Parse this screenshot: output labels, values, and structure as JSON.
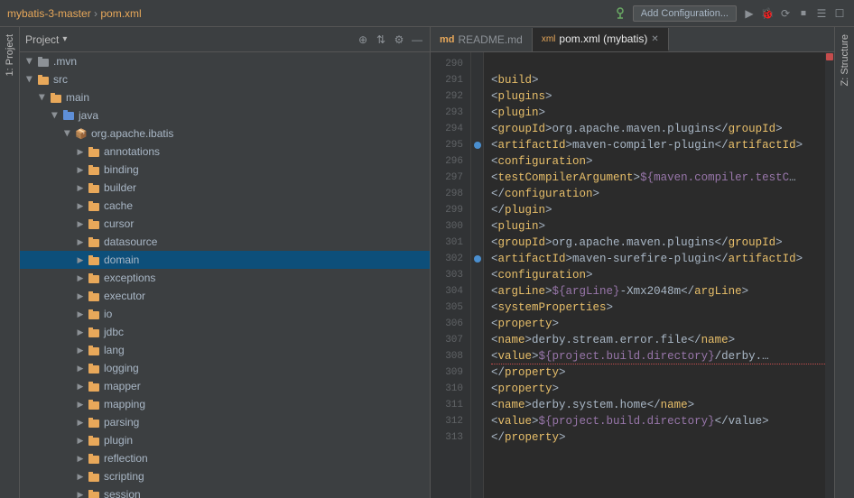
{
  "titleBar": {
    "projectName": "mybatis-3-master",
    "separator": " › ",
    "fileName": "pom.xml",
    "addConfigLabel": "Add Configuration...",
    "icons": [
      "▶",
      "⏸",
      "⟳",
      "⏹",
      "☰",
      "☐"
    ]
  },
  "projectPanel": {
    "title": "Project",
    "dropdownArrow": "▾",
    "headerIcons": [
      "⊕",
      "⇅",
      "⚙",
      "—"
    ]
  },
  "tabs": [
    {
      "id": "readme",
      "label": "README.md",
      "iconType": "md",
      "active": false
    },
    {
      "id": "pomxml",
      "label": "pom.xml (mybatis)",
      "iconType": "xml",
      "active": true
    }
  ],
  "fileTree": [
    {
      "indent": 0,
      "type": "folder",
      "open": true,
      "label": ".mvn",
      "color": "gray"
    },
    {
      "indent": 0,
      "type": "folder",
      "open": true,
      "label": "src",
      "color": "orange"
    },
    {
      "indent": 1,
      "type": "folder",
      "open": true,
      "label": "main",
      "color": "orange"
    },
    {
      "indent": 2,
      "type": "folder",
      "open": true,
      "label": "java",
      "color": "blue"
    },
    {
      "indent": 3,
      "type": "package",
      "open": true,
      "label": "org.apache.ibatis",
      "color": "package"
    },
    {
      "indent": 4,
      "type": "folder",
      "open": false,
      "label": "annotations",
      "color": "orange"
    },
    {
      "indent": 4,
      "type": "folder",
      "open": false,
      "label": "binding",
      "color": "orange"
    },
    {
      "indent": 4,
      "type": "folder",
      "open": false,
      "label": "builder",
      "color": "orange"
    },
    {
      "indent": 4,
      "type": "folder",
      "open": false,
      "label": "cache",
      "color": "orange"
    },
    {
      "indent": 4,
      "type": "folder",
      "open": false,
      "label": "cursor",
      "color": "orange"
    },
    {
      "indent": 4,
      "type": "folder",
      "open": false,
      "label": "datasource",
      "color": "orange"
    },
    {
      "indent": 4,
      "type": "folder",
      "open": false,
      "label": "domain",
      "color": "orange",
      "selected": true
    },
    {
      "indent": 4,
      "type": "folder",
      "open": false,
      "label": "exceptions",
      "color": "orange"
    },
    {
      "indent": 4,
      "type": "folder",
      "open": false,
      "label": "executor",
      "color": "orange"
    },
    {
      "indent": 4,
      "type": "folder",
      "open": false,
      "label": "io",
      "color": "orange"
    },
    {
      "indent": 4,
      "type": "folder",
      "open": false,
      "label": "jdbc",
      "color": "orange"
    },
    {
      "indent": 4,
      "type": "folder",
      "open": false,
      "label": "lang",
      "color": "orange"
    },
    {
      "indent": 4,
      "type": "folder",
      "open": false,
      "label": "logging",
      "color": "orange"
    },
    {
      "indent": 4,
      "type": "folder",
      "open": false,
      "label": "mapper",
      "color": "orange"
    },
    {
      "indent": 4,
      "type": "folder",
      "open": false,
      "label": "mapping",
      "color": "orange"
    },
    {
      "indent": 4,
      "type": "folder",
      "open": false,
      "label": "parsing",
      "color": "orange"
    },
    {
      "indent": 4,
      "type": "folder",
      "open": false,
      "label": "plugin",
      "color": "orange"
    },
    {
      "indent": 4,
      "type": "folder",
      "open": false,
      "label": "reflection",
      "color": "orange"
    },
    {
      "indent": 4,
      "type": "folder",
      "open": false,
      "label": "scripting",
      "color": "orange"
    },
    {
      "indent": 4,
      "type": "folder",
      "open": false,
      "label": "session",
      "color": "orange"
    }
  ],
  "codeLines": [
    {
      "num": 290,
      "hasGutter": false,
      "hasDot": false,
      "error": false,
      "tokens": [
        {
          "type": "plain",
          "text": "  "
        }
      ]
    },
    {
      "num": 291,
      "hasGutter": false,
      "hasDot": false,
      "error": false,
      "tokens": [
        {
          "type": "plain",
          "text": "    "
        },
        {
          "type": "bracket",
          "text": "<"
        },
        {
          "type": "tag",
          "text": "build"
        },
        {
          "type": "bracket",
          "text": ">"
        }
      ]
    },
    {
      "num": 292,
      "hasGutter": false,
      "hasDot": false,
      "error": false,
      "tokens": [
        {
          "type": "plain",
          "text": "        "
        },
        {
          "type": "bracket",
          "text": "<"
        },
        {
          "type": "tag",
          "text": "plugins"
        },
        {
          "type": "bracket",
          "text": ">"
        }
      ]
    },
    {
      "num": 293,
      "hasGutter": false,
      "hasDot": false,
      "error": false,
      "tokens": [
        {
          "type": "plain",
          "text": "            "
        },
        {
          "type": "bracket",
          "text": "<"
        },
        {
          "type": "tag",
          "text": "plugin"
        },
        {
          "type": "bracket",
          "text": ">"
        }
      ]
    },
    {
      "num": 294,
      "hasGutter": false,
      "hasDot": false,
      "error": false,
      "tokens": [
        {
          "type": "plain",
          "text": "                "
        },
        {
          "type": "bracket",
          "text": "<"
        },
        {
          "type": "tag",
          "text": "groupId"
        },
        {
          "type": "bracket",
          "text": ">"
        },
        {
          "type": "plain",
          "text": "org.apache.maven.plugins"
        },
        {
          "type": "bracket",
          "text": "</"
        },
        {
          "type": "tag",
          "text": "groupId"
        },
        {
          "type": "bracket",
          "text": ">"
        }
      ]
    },
    {
      "num": 295,
      "hasGutter": true,
      "hasDot": true,
      "error": false,
      "tokens": [
        {
          "type": "plain",
          "text": "                "
        },
        {
          "type": "bracket",
          "text": "<"
        },
        {
          "type": "tag",
          "text": "artifactId"
        },
        {
          "type": "bracket",
          "text": ">"
        },
        {
          "type": "plain",
          "text": "maven-compiler-plugin"
        },
        {
          "type": "bracket",
          "text": "</"
        },
        {
          "type": "tag",
          "text": "artifactId"
        },
        {
          "type": "bracket",
          "text": ">"
        }
      ]
    },
    {
      "num": 296,
      "hasGutter": false,
      "hasDot": false,
      "error": false,
      "tokens": [
        {
          "type": "plain",
          "text": "                "
        },
        {
          "type": "bracket",
          "text": "<"
        },
        {
          "type": "tag",
          "text": "configuration"
        },
        {
          "type": "bracket",
          "text": ">"
        }
      ]
    },
    {
      "num": 297,
      "hasGutter": false,
      "hasDot": false,
      "error": false,
      "tokens": [
        {
          "type": "plain",
          "text": "                    "
        },
        {
          "type": "bracket",
          "text": "<"
        },
        {
          "type": "tag",
          "text": "testCompilerArgument"
        },
        {
          "type": "bracket",
          "text": ">"
        },
        {
          "type": "var",
          "text": "${maven.compiler.testC"
        },
        {
          "type": "plain",
          "text": "…"
        }
      ]
    },
    {
      "num": 298,
      "hasGutter": false,
      "hasDot": false,
      "error": false,
      "tokens": [
        {
          "type": "plain",
          "text": "                "
        },
        {
          "type": "bracket",
          "text": "</"
        },
        {
          "type": "tag",
          "text": "configuration"
        },
        {
          "type": "bracket",
          "text": ">"
        }
      ]
    },
    {
      "num": 299,
      "hasGutter": false,
      "hasDot": false,
      "error": false,
      "tokens": [
        {
          "type": "plain",
          "text": "            "
        },
        {
          "type": "bracket",
          "text": "</"
        },
        {
          "type": "tag",
          "text": "plugin"
        },
        {
          "type": "bracket",
          "text": ">"
        }
      ]
    },
    {
      "num": 300,
      "hasGutter": false,
      "hasDot": false,
      "error": false,
      "tokens": [
        {
          "type": "plain",
          "text": "            "
        },
        {
          "type": "bracket",
          "text": "<"
        },
        {
          "type": "tag",
          "text": "plugin"
        },
        {
          "type": "bracket",
          "text": ">"
        }
      ]
    },
    {
      "num": 301,
      "hasGutter": false,
      "hasDot": false,
      "error": false,
      "tokens": [
        {
          "type": "plain",
          "text": "                "
        },
        {
          "type": "bracket",
          "text": "<"
        },
        {
          "type": "tag",
          "text": "groupId"
        },
        {
          "type": "bracket",
          "text": ">"
        },
        {
          "type": "plain",
          "text": "org.apache.maven.plugins"
        },
        {
          "type": "bracket",
          "text": "</"
        },
        {
          "type": "tag",
          "text": "groupId"
        },
        {
          "type": "bracket",
          "text": ">"
        }
      ]
    },
    {
      "num": 302,
      "hasGutter": true,
      "hasDot": true,
      "error": false,
      "tokens": [
        {
          "type": "plain",
          "text": "                "
        },
        {
          "type": "bracket",
          "text": "<"
        },
        {
          "type": "tag",
          "text": "artifactId"
        },
        {
          "type": "bracket",
          "text": ">"
        },
        {
          "type": "plain",
          "text": "maven-surefire-plugin"
        },
        {
          "type": "bracket",
          "text": "</"
        },
        {
          "type": "tag",
          "text": "artifactId"
        },
        {
          "type": "bracket",
          "text": ">"
        }
      ]
    },
    {
      "num": 303,
      "hasGutter": false,
      "hasDot": false,
      "error": false,
      "tokens": [
        {
          "type": "plain",
          "text": "                "
        },
        {
          "type": "bracket",
          "text": "<"
        },
        {
          "type": "tag",
          "text": "configuration"
        },
        {
          "type": "bracket",
          "text": ">"
        }
      ]
    },
    {
      "num": 304,
      "hasGutter": false,
      "hasDot": false,
      "error": false,
      "tokens": [
        {
          "type": "plain",
          "text": "                    "
        },
        {
          "type": "bracket",
          "text": "<"
        },
        {
          "type": "tag",
          "text": "argLine"
        },
        {
          "type": "bracket",
          "text": ">"
        },
        {
          "type": "var",
          "text": "${argLine}"
        },
        {
          "type": "plain",
          "text": " -Xmx2048m"
        },
        {
          "type": "bracket",
          "text": "</"
        },
        {
          "type": "tag",
          "text": "argLine"
        },
        {
          "type": "bracket",
          "text": ">"
        }
      ]
    },
    {
      "num": 305,
      "hasGutter": false,
      "hasDot": false,
      "error": false,
      "tokens": [
        {
          "type": "plain",
          "text": "                    "
        },
        {
          "type": "bracket",
          "text": "<"
        },
        {
          "type": "tag",
          "text": "systemProperties"
        },
        {
          "type": "bracket",
          "text": ">"
        }
      ]
    },
    {
      "num": 306,
      "hasGutter": false,
      "hasDot": false,
      "error": false,
      "tokens": [
        {
          "type": "plain",
          "text": "                        "
        },
        {
          "type": "bracket",
          "text": "<"
        },
        {
          "type": "tag",
          "text": "property"
        },
        {
          "type": "bracket",
          "text": ">"
        }
      ]
    },
    {
      "num": 307,
      "hasGutter": false,
      "hasDot": false,
      "error": false,
      "tokens": [
        {
          "type": "plain",
          "text": "                            "
        },
        {
          "type": "bracket",
          "text": "<"
        },
        {
          "type": "tag",
          "text": "name"
        },
        {
          "type": "bracket",
          "text": ">"
        },
        {
          "type": "plain",
          "text": "derby.stream.error.file"
        },
        {
          "type": "bracket",
          "text": "</"
        },
        {
          "type": "tag",
          "text": "name"
        },
        {
          "type": "bracket",
          "text": ">"
        }
      ]
    },
    {
      "num": 308,
      "hasGutter": false,
      "hasDot": false,
      "error": true,
      "tokens": [
        {
          "type": "plain",
          "text": "                            "
        },
        {
          "type": "bracket",
          "text": "<"
        },
        {
          "type": "tag",
          "text": "value"
        },
        {
          "type": "bracket",
          "text": ">"
        },
        {
          "type": "var",
          "text": "${project.build.directory}"
        },
        {
          "type": "plain",
          "text": "/derby."
        },
        {
          "type": "plain",
          "text": "…"
        }
      ]
    },
    {
      "num": 309,
      "hasGutter": false,
      "hasDot": false,
      "error": false,
      "tokens": [
        {
          "type": "plain",
          "text": "                        "
        },
        {
          "type": "bracket",
          "text": "</"
        },
        {
          "type": "tag",
          "text": "property"
        },
        {
          "type": "bracket",
          "text": ">"
        }
      ]
    },
    {
      "num": 310,
      "hasGutter": false,
      "hasDot": false,
      "error": false,
      "tokens": [
        {
          "type": "plain",
          "text": "                        "
        },
        {
          "type": "bracket",
          "text": "<"
        },
        {
          "type": "tag",
          "text": "property"
        },
        {
          "type": "bracket",
          "text": ">"
        }
      ]
    },
    {
      "num": 311,
      "hasGutter": false,
      "hasDot": false,
      "error": false,
      "tokens": [
        {
          "type": "plain",
          "text": "                            "
        },
        {
          "type": "bracket",
          "text": "<"
        },
        {
          "type": "tag",
          "text": "name"
        },
        {
          "type": "bracket",
          "text": ">"
        },
        {
          "type": "plain",
          "text": "derby.system.home"
        },
        {
          "type": "bracket",
          "text": "</"
        },
        {
          "type": "tag",
          "text": "name"
        },
        {
          "type": "bracket",
          "text": ">"
        }
      ]
    },
    {
      "num": 312,
      "hasGutter": false,
      "hasDot": false,
      "error": false,
      "tokens": [
        {
          "type": "plain",
          "text": "                            "
        },
        {
          "type": "bracket",
          "text": "<"
        },
        {
          "type": "tag",
          "text": "value"
        },
        {
          "type": "bracket",
          "text": ">"
        },
        {
          "type": "var",
          "text": "${project.build.directory}"
        },
        {
          "type": "plain",
          "text": "</value>"
        }
      ]
    },
    {
      "num": 313,
      "hasGutter": false,
      "hasDot": false,
      "error": false,
      "tokens": [
        {
          "type": "plain",
          "text": "                        "
        },
        {
          "type": "bracket",
          "text": "</"
        },
        {
          "type": "tag",
          "text": "property"
        },
        {
          "type": "bracket",
          "text": ">"
        }
      ]
    }
  ],
  "topErrorDot": true,
  "sidebarVerticalLabels": [
    "1: Project"
  ],
  "structureVerticalLabels": [
    "Z: Structure"
  ]
}
